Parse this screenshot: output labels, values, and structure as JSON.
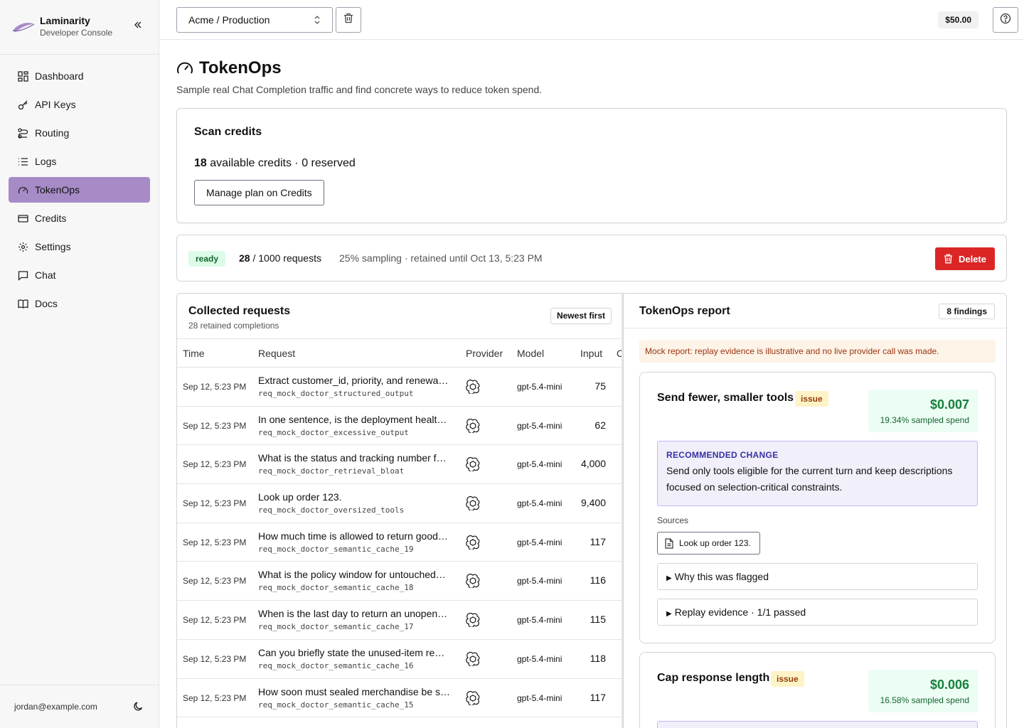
{
  "sidebar": {
    "brand_name": "Laminarity",
    "brand_sub": "Developer Console",
    "items": [
      {
        "label": "Dashboard",
        "icon": "dashboard-icon"
      },
      {
        "label": "API Keys",
        "icon": "key-icon"
      },
      {
        "label": "Routing",
        "icon": "routing-icon"
      },
      {
        "label": "Logs",
        "icon": "list-icon"
      },
      {
        "label": "TokenOps",
        "icon": "gauge-icon",
        "active": true
      },
      {
        "label": "Credits",
        "icon": "credit-card-icon"
      },
      {
        "label": "Settings",
        "icon": "gear-icon"
      },
      {
        "label": "Chat",
        "icon": "chat-icon"
      },
      {
        "label": "Docs",
        "icon": "book-icon"
      }
    ],
    "user_email": "jordan@example.com"
  },
  "topbar": {
    "workspace": "Acme / Production",
    "balance": "$50.00"
  },
  "page": {
    "title": "TokenOps",
    "subtitle": "Sample real Chat Completion traffic and find concrete ways to reduce token spend."
  },
  "credits": {
    "title": "Scan credits",
    "available": "18",
    "available_suffix": " available credits · 0 reserved",
    "manage_label": "Manage plan on Credits"
  },
  "status": {
    "badge": "ready",
    "count": "28",
    "count_suffix": " / 1000 requests",
    "meta": "25% sampling · retained until Oct 13, 5:23 PM",
    "delete_label": "Delete"
  },
  "requests": {
    "title": "Collected requests",
    "subtitle": "28 retained completions",
    "sort_label": "Newest first",
    "columns": {
      "time": "Time",
      "request": "Request",
      "provider": "Provider",
      "model": "Model",
      "input": "Input",
      "clipped": "C"
    },
    "rows": [
      {
        "time": "Sep 12, 5:23 PM",
        "request": "Extract customer_id, priority, and renewa…",
        "id": "req_mock_doctor_structured_output",
        "model": "gpt-5.4-mini",
        "input": "75"
      },
      {
        "time": "Sep 12, 5:23 PM",
        "request": "In one sentence, is the deployment healt…",
        "id": "req_mock_doctor_excessive_output",
        "model": "gpt-5.4-mini",
        "input": "62"
      },
      {
        "time": "Sep 12, 5:23 PM",
        "request": "What is the status and tracking number f…",
        "id": "req_mock_doctor_retrieval_bloat",
        "model": "gpt-5.4-mini",
        "input": "4,000"
      },
      {
        "time": "Sep 12, 5:23 PM",
        "request": "Look up order 123.",
        "id": "req_mock_doctor_oversized_tools",
        "model": "gpt-5.4-mini",
        "input": "9,400"
      },
      {
        "time": "Sep 12, 5:23 PM",
        "request": "How much time is allowed to return good…",
        "id": "req_mock_doctor_semantic_cache_19",
        "model": "gpt-5.4-mini",
        "input": "117"
      },
      {
        "time": "Sep 12, 5:23 PM",
        "request": "What is the policy window for untouched…",
        "id": "req_mock_doctor_semantic_cache_18",
        "model": "gpt-5.4-mini",
        "input": "116"
      },
      {
        "time": "Sep 12, 5:23 PM",
        "request": "When is the last day to return an unopen…",
        "id": "req_mock_doctor_semantic_cache_17",
        "model": "gpt-5.4-mini",
        "input": "115"
      },
      {
        "time": "Sep 12, 5:23 PM",
        "request": "Can you briefly state the unused-item re…",
        "id": "req_mock_doctor_semantic_cache_16",
        "model": "gpt-5.4-mini",
        "input": "118"
      },
      {
        "time": "Sep 12, 5:23 PM",
        "request": "How soon must sealed merchandise be s…",
        "id": "req_mock_doctor_semantic_cache_15",
        "model": "gpt-5.4-mini",
        "input": "117"
      }
    ]
  },
  "report": {
    "title": "TokenOps report",
    "findings_count": "8 findings",
    "mock_note": "Mock report: replay evidence is illustrative and no live provider call was made.",
    "findings": [
      {
        "title": "Send fewer, smaller tools",
        "badge": "issue",
        "amount": "$0.007",
        "percent": "19.34% sampled spend",
        "rec_label": "RECOMMENDED CHANGE",
        "rec_text": "Send only tools eligible for the current turn and keep descriptions focused on selection-critical constraints.",
        "sources_label": "Sources",
        "source": "Look up order 123.",
        "why": "Why this was flagged",
        "replay": "Replay evidence · 1/1 passed"
      },
      {
        "title": "Cap response length",
        "badge": "issue",
        "amount": "$0.006",
        "percent": "16.58% sampled spend"
      }
    ]
  }
}
